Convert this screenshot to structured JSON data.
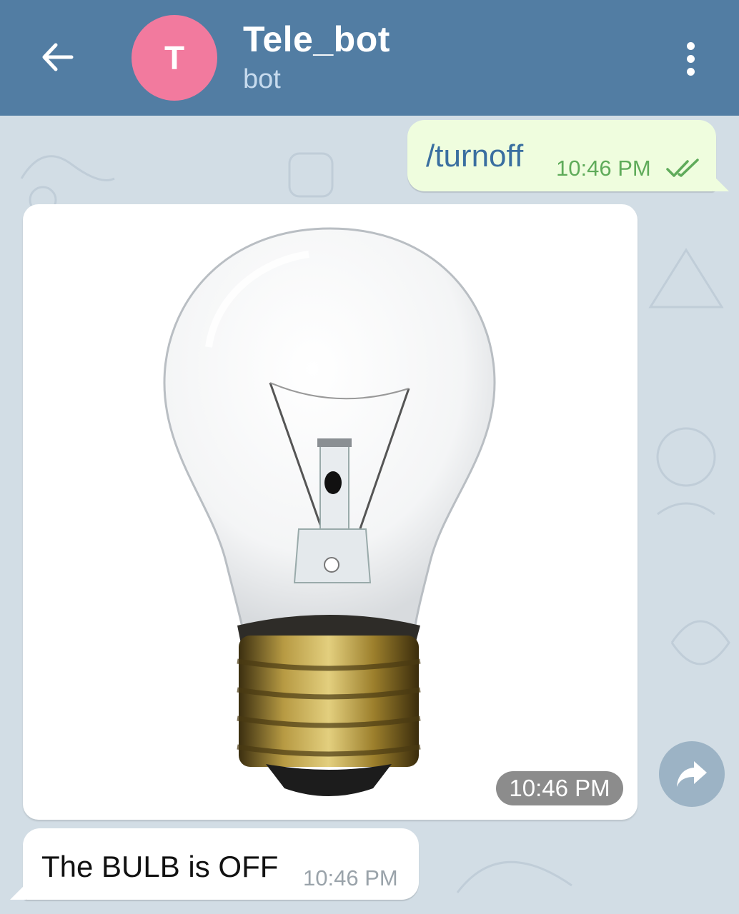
{
  "header": {
    "avatar_letter": "T",
    "title": "Tele_bot",
    "subtitle": "bot",
    "back_icon": "arrow-left-icon",
    "menu_icon": "more-vertical-icon",
    "bg_color": "#527da3",
    "avatar_color": "#f27a9e"
  },
  "messages": [
    {
      "direction": "outgoing",
      "text": "/turnoff",
      "time": "10:46 PM",
      "status_icon": "double-check-icon"
    },
    {
      "direction": "incoming",
      "type": "photo",
      "image": "light-bulb",
      "time": "10:46 PM",
      "action_icon": "share-icon"
    },
    {
      "direction": "incoming",
      "text": "The BULB is OFF",
      "time": "10:46 PM"
    }
  ],
  "colors": {
    "chat_bg": "#d2dde5",
    "outgoing_bubble": "#effdde",
    "incoming_bubble": "#ffffff"
  }
}
